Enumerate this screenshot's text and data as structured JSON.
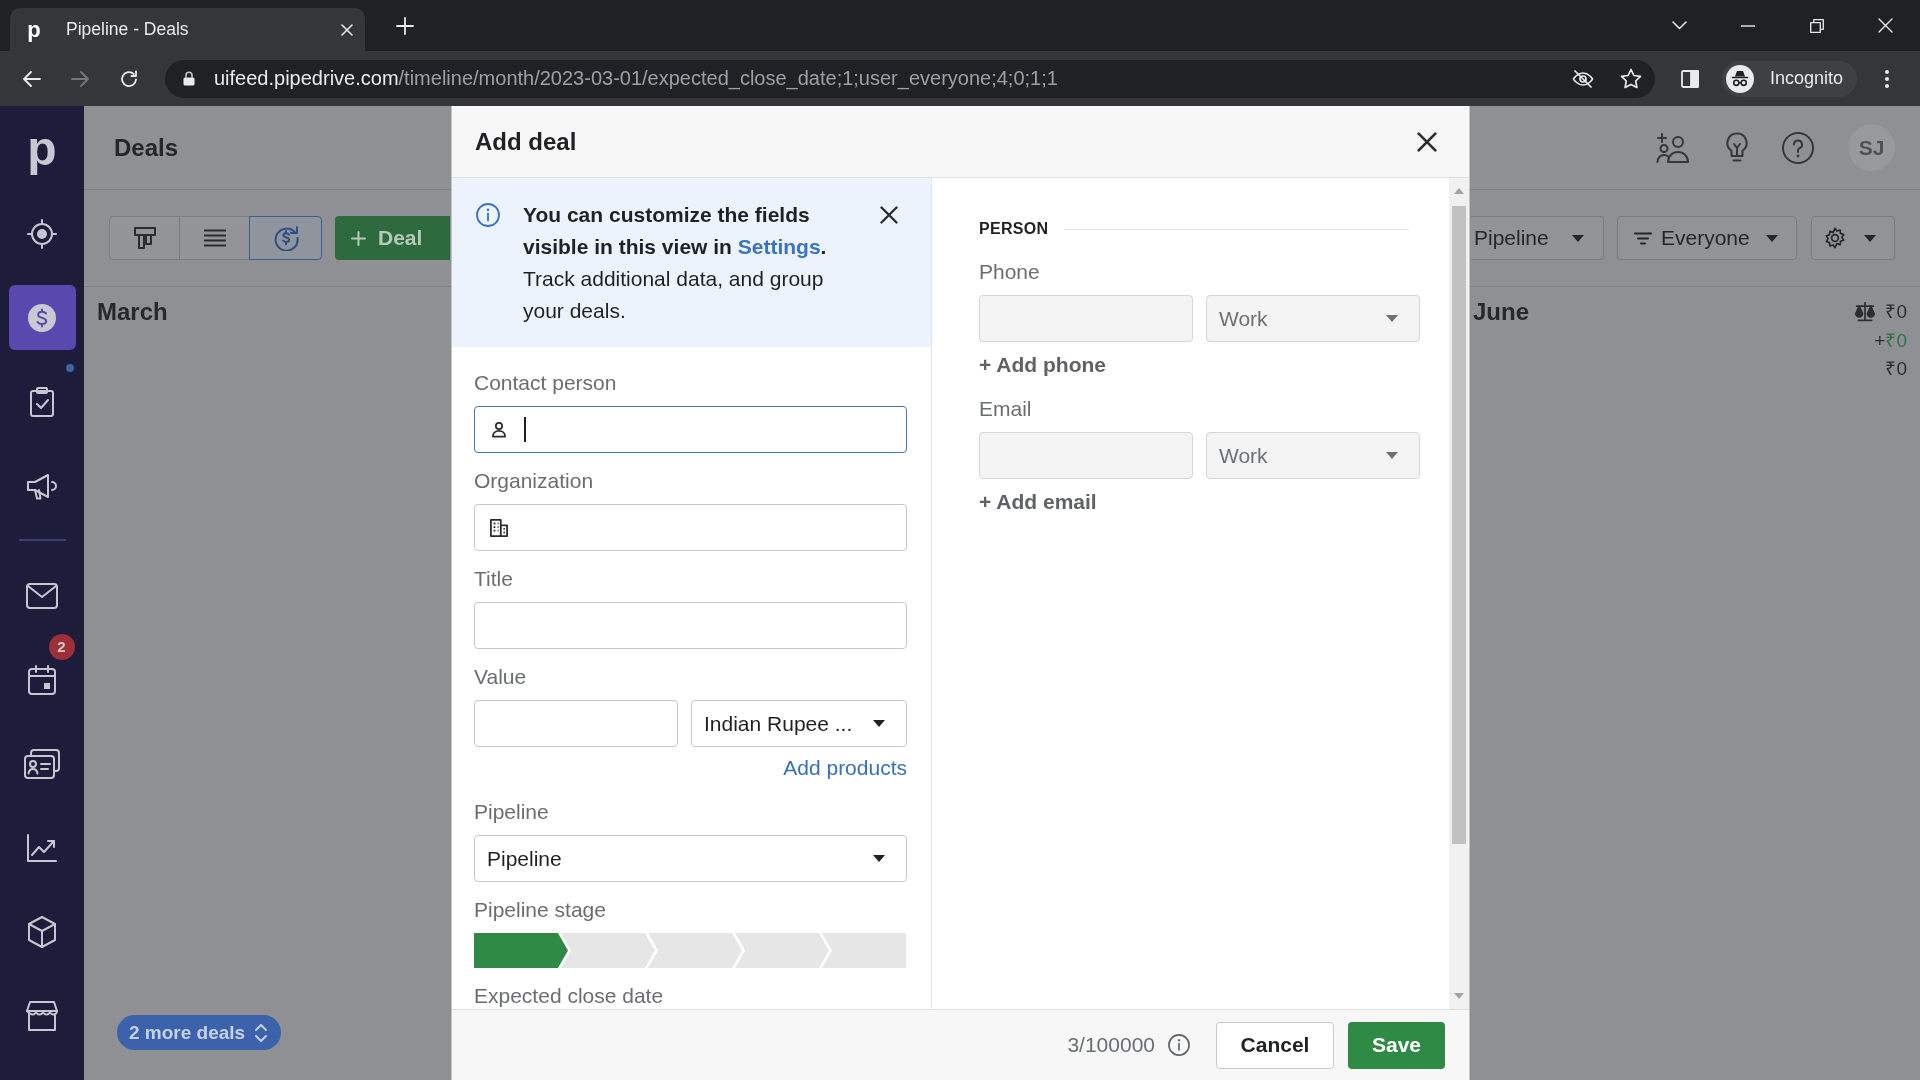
{
  "browser": {
    "tab": {
      "favicon": "p",
      "title": "Pipeline - Deals"
    },
    "address": {
      "host": "uifeed.pipedrive.com",
      "path": "/timeline/month/2023-03-01/expected_close_date;1;user_everyone;4;0;1;1"
    },
    "profile": "Incognito"
  },
  "sidebar": {
    "logo": "p",
    "groups": [
      [
        {
          "selected": false,
          "notification": false
        },
        {
          "selected": true,
          "notification": false
        },
        {
          "selected": false,
          "notification": true
        },
        {
          "selected": false,
          "notification": false
        }
      ],
      [
        {
          "selected": false,
          "notification": false
        },
        {
          "selected": false,
          "notification": false,
          "badge": "2"
        },
        {
          "selected": false,
          "notification": false
        },
        {
          "selected": false,
          "notification": false
        },
        {
          "selected": false,
          "notification": false
        },
        {
          "selected": false,
          "notification": false
        }
      ]
    ]
  },
  "header": {
    "title": "Deals",
    "avatar": "SJ"
  },
  "toolbar": {
    "views": [
      {
        "selected": false
      },
      {
        "selected": false
      },
      {
        "selected": true
      }
    ],
    "add_button": "Deal",
    "pipeline": "Pipeline",
    "filter": "Everyone"
  },
  "timeline": {
    "months": [
      {
        "name": "March",
        "more_deals": "2 more deals"
      },
      {
        "name": "June",
        "totals": {
          "weighted": "₹0",
          "won_sign": "+",
          "won": "₹0",
          "total": "₹0"
        }
      }
    ]
  },
  "dialog": {
    "title": "Add deal",
    "notice": {
      "lead": "You can customize the fields visible in this view in",
      "link": "Settings",
      "lead_end": ".",
      "text": "Track additional data, and group your deals."
    },
    "fields": [
      {
        "kind": "person",
        "label": "Contact person",
        "focused": true
      },
      {
        "kind": "organization",
        "label": "Organization",
        "focused": false
      },
      {
        "kind": "text",
        "label": "Title",
        "focused": false
      },
      {
        "kind": "money",
        "label": "Value",
        "focused": false,
        "currency": "Indian Rupee ...",
        "link": "Add products"
      },
      {
        "kind": "select",
        "label": "Pipeline",
        "focused": false,
        "value": "Pipeline"
      },
      {
        "kind": "stages",
        "label": "Pipeline stage",
        "stages": [
          {
            "selected": true
          },
          {
            "selected": false
          },
          {
            "selected": false
          },
          {
            "selected": false
          },
          {
            "selected": false
          }
        ]
      },
      {
        "kind": "date",
        "label": "Expected close date"
      }
    ],
    "person": {
      "heading": "PERSON",
      "groups": [
        {
          "label": "Phone",
          "type": "Work",
          "add": "+ Add phone"
        },
        {
          "label": "Email",
          "type": "Work",
          "add": "+ Add email"
        }
      ]
    },
    "footer": {
      "counter": "3/100000",
      "cancel": "Cancel",
      "save": "Save"
    }
  }
}
